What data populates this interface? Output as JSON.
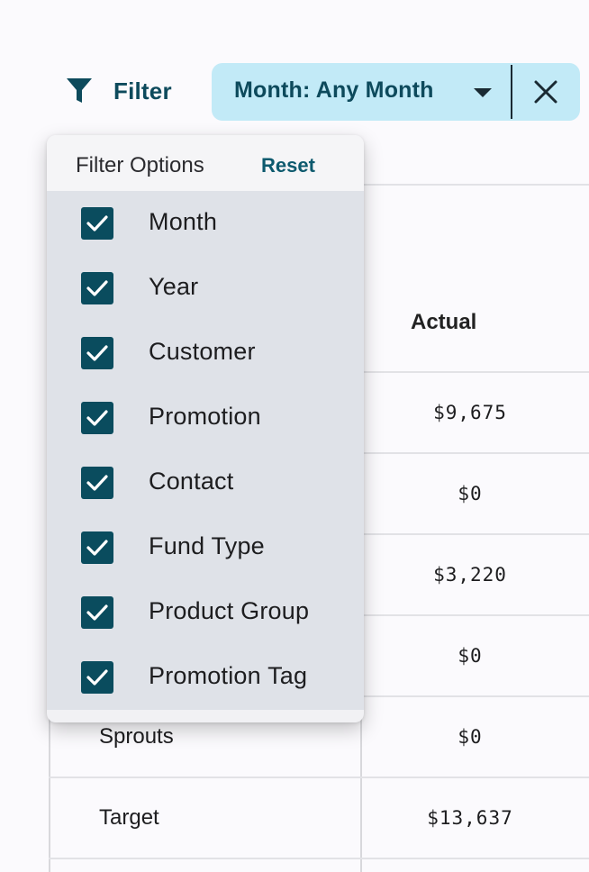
{
  "toolbar": {
    "filter_label": "Filter",
    "filter_icon": "funnel-icon",
    "chip_label": "Month: Any Month",
    "chip_caret_icon": "caret-down-icon",
    "chip_close_icon": "close-icon"
  },
  "panel": {
    "title": "Filter Options",
    "reset_label": "Reset",
    "options": [
      {
        "label": "Month",
        "checked": true
      },
      {
        "label": "Year",
        "checked": true
      },
      {
        "label": "Customer",
        "checked": true
      },
      {
        "label": "Promotion",
        "checked": true
      },
      {
        "label": "Contact",
        "checked": true
      },
      {
        "label": "Fund Type",
        "checked": true
      },
      {
        "label": "Product Group",
        "checked": true
      },
      {
        "label": "Promotion Tag",
        "checked": true
      }
    ]
  },
  "table": {
    "actual_header": "Actual",
    "actual_values": [
      "$9,675",
      "$0",
      "$3,220",
      "$0",
      "$0",
      "$13,637"
    ],
    "visible_names": [
      "Sprouts",
      "Target"
    ]
  },
  "colors": {
    "accent": "#0d4a5c",
    "chip_background": "#c2eaf7",
    "checkbox": "#0a4c5e"
  }
}
